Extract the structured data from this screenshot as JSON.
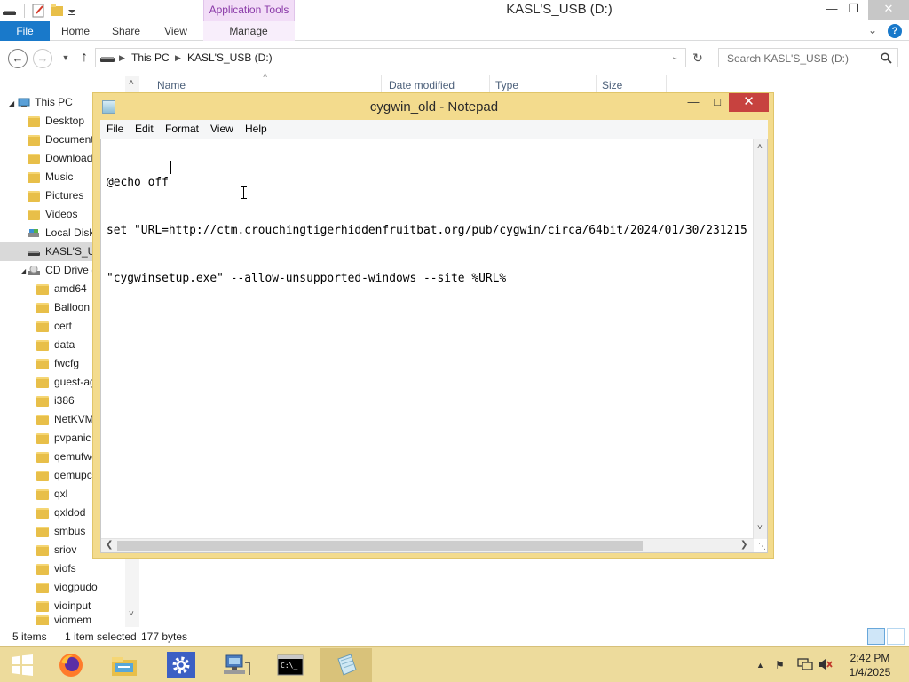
{
  "explorer": {
    "title": "KASL'S_USB (D:)",
    "context_tab": "Application Tools",
    "ribbon_tabs": [
      "File",
      "Home",
      "Share",
      "View",
      "Manage"
    ],
    "address": {
      "crumbs": [
        "This PC",
        "KASL'S_USB (D:)"
      ]
    },
    "search_placeholder": "Search KASL'S_USB (D:)",
    "columns": [
      "Name",
      "Date modified",
      "Type",
      "Size"
    ],
    "nav": {
      "this_pc": "This PC",
      "items": [
        "Desktop",
        "Documents",
        "Downloads",
        "Music",
        "Pictures",
        "Videos",
        "Local Disk",
        "KASL'S_USB",
        "CD Drive ("
      ],
      "folders": [
        "amd64",
        "Balloon",
        "cert",
        "data",
        "fwcfg",
        "guest-agent",
        "i386",
        "NetKVM",
        "pvpanic",
        "qemufwcfg",
        "qemupciserial",
        "qxl",
        "qxldod",
        "smbus",
        "sriov",
        "viofs",
        "viogpudo",
        "vioinput",
        "viomem"
      ]
    },
    "status": {
      "items": "5 items",
      "selected": "1 item selected",
      "size": "177 bytes"
    }
  },
  "notepad": {
    "title": "cygwin_old - Notepad",
    "menu": [
      "File",
      "Edit",
      "Format",
      "View",
      "Help"
    ],
    "lines": [
      "@echo off",
      "set \"URL=http://ctm.crouchingtigerhiddenfruitbat.org/pub/cygwin/circa/64bit/2024/01/30/231215",
      "\"cygwinsetup.exe\" --allow-unsupported-windows --site %URL%"
    ]
  },
  "taskbar": {
    "apps": [
      "start-icon",
      "firefox-icon",
      "file-explorer-icon",
      "settings-icon",
      "network-icon",
      "command-prompt-icon",
      "notepad-icon"
    ],
    "clock": {
      "time": "2:42 PM",
      "date": "1/4/2025"
    }
  },
  "colors": {
    "accent": "#1979ca",
    "notepad_frame": "#f3db8d",
    "close_red": "#c7423f",
    "taskbar": "#eddb9c"
  }
}
